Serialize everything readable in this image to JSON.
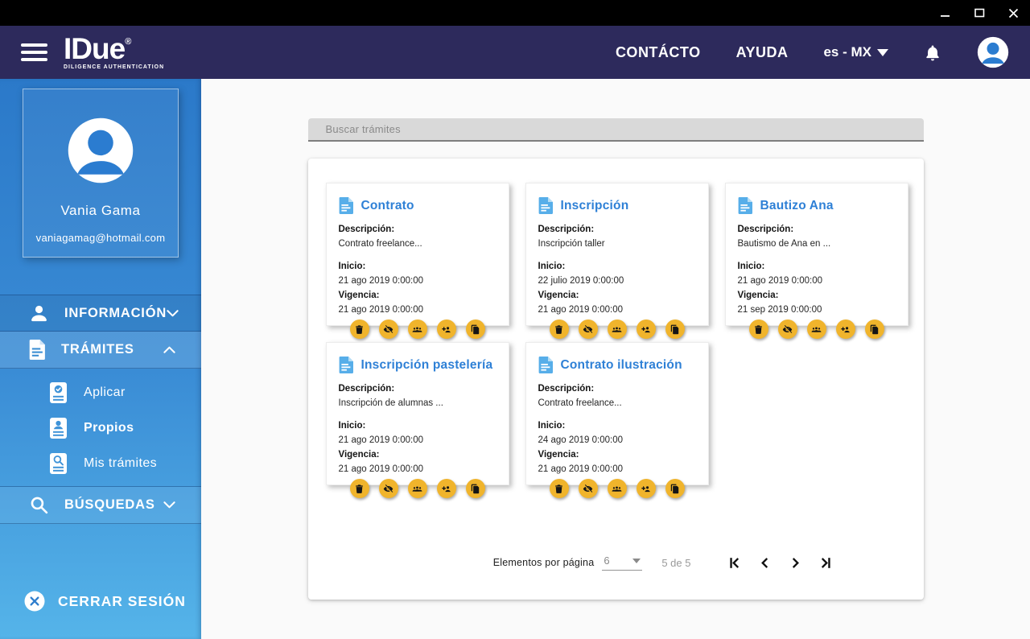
{
  "window": {
    "controls": [
      "minimize",
      "maximize",
      "close"
    ]
  },
  "header": {
    "logo": {
      "title": "IDue",
      "registered": "®",
      "subtitle": "DILIGENCE AUTHENTICATION"
    },
    "nav": [
      {
        "label": "CONTÁCTO"
      },
      {
        "label": "AYUDA"
      }
    ],
    "language": {
      "value": "es - MX"
    },
    "icons": [
      "menu-icon",
      "bell-icon",
      "avatar-icon"
    ]
  },
  "sidebar": {
    "profile": {
      "name": "Vania Gama",
      "email": "vaniagamag@hotmail.com"
    },
    "items": [
      {
        "label": "INFORMACIÓN",
        "icon": "person-icon",
        "state": "collapsed"
      },
      {
        "label": "TRÁMITES",
        "icon": "document-icon",
        "state": "expanded"
      },
      {
        "label": "BÚSQUEDAS",
        "icon": "search-icon",
        "state": "collapsed"
      }
    ],
    "tramites_children": [
      {
        "label": "Aplicar",
        "icon": "doc-check-icon"
      },
      {
        "label": "Propios",
        "icon": "doc-person-icon",
        "active": true
      },
      {
        "label": "Mis trámites",
        "icon": "doc-search-icon"
      }
    ],
    "logout_label": "CERRAR SESIÓN"
  },
  "search": {
    "placeholder": "Buscar trámites",
    "value": ""
  },
  "card_labels": {
    "description": "Descripción:",
    "inicio": "Inicio:",
    "vigencia": "Vigencia:"
  },
  "card_actions": [
    "delete",
    "preview",
    "participants",
    "add-participant",
    "copy"
  ],
  "cards": [
    {
      "title": "Contrato",
      "description": "Contrato freelance...",
      "inicio": "21 ago 2019 0:00:00",
      "vigencia": "21 ago 2019 0:00:00"
    },
    {
      "title": "Inscripción",
      "description": "Inscripción taller",
      "inicio": "22 julio 2019 0:00:00",
      "vigencia": "21 ago 2019 0:00:00"
    },
    {
      "title": "Bautizo Ana",
      "description": "Bautismo de Ana en ...",
      "inicio": "21 ago 2019 0:00:00",
      "vigencia": "21 sep 2019 0:00:00"
    },
    {
      "title": "Inscripción pastelería",
      "description": "Inscripción de alumnas ...",
      "inicio": "21 ago 2019 0:00:00",
      "vigencia": "21 ago 2019 0:00:00"
    },
    {
      "title": "Contrato ilustración",
      "description": "Contrato freelance...",
      "inicio": "24 ago 2019 0:00:00",
      "vigencia": "21 ago 2019 0:00:00"
    }
  ],
  "pagination": {
    "items_per_page_label": "Elementos por página",
    "items_per_page": "6",
    "range_label": "5 de 5",
    "controls": [
      "first-page",
      "previous-page",
      "next-page",
      "last-page"
    ]
  },
  "colors": {
    "header_navy": "#2d2a5c",
    "sidebar_blue_top": "#2b79c9",
    "sidebar_blue_bottom": "#55b4e9",
    "accent_blue": "#2e80d6",
    "action_yellow": "#f0b42c"
  }
}
